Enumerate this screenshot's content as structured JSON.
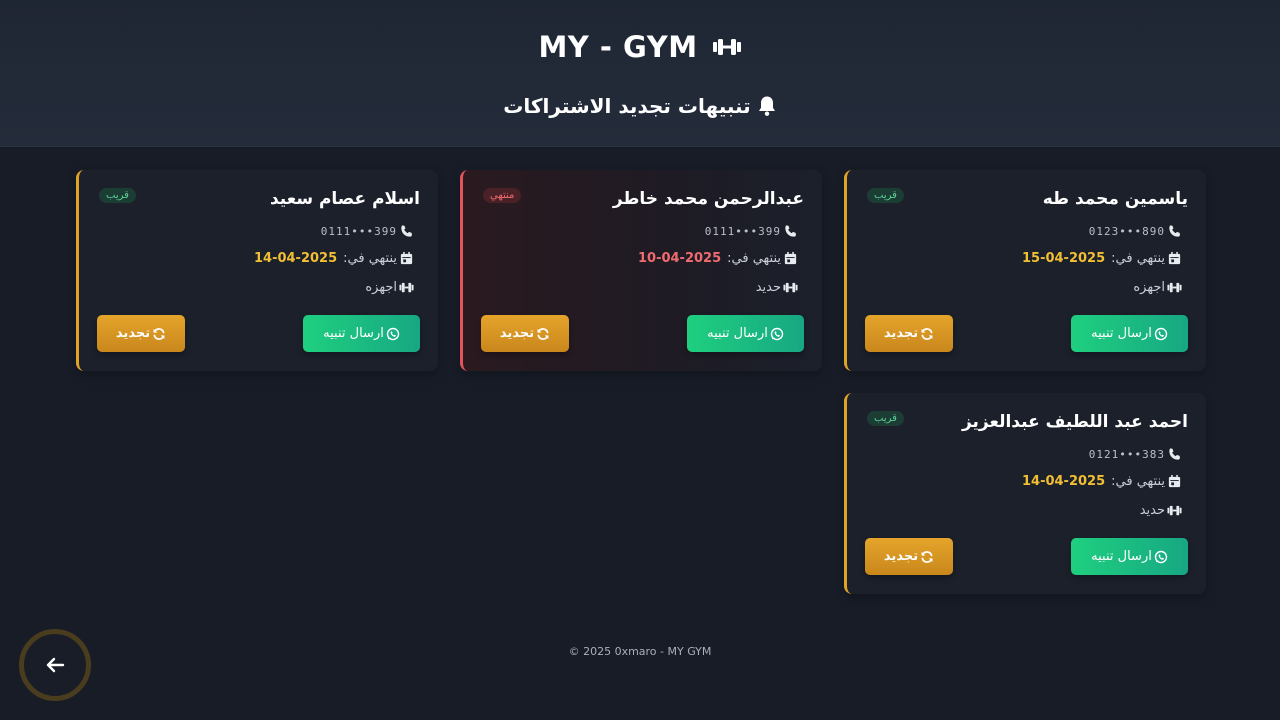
{
  "header": {
    "brand": "MY - GYM",
    "brand_icon": "dumbbell-icon",
    "subtitle": "تنبيهات تجديد الاشتراكات",
    "subtitle_icon": "bell-icon"
  },
  "labels": {
    "ends_on": "ينتهي في:",
    "send_alert": "ارسال تنبيه",
    "renew": "تجديد"
  },
  "colors": {
    "accent_gold": "#e0a328",
    "expired_red": "#e0545a",
    "whatsapp_green": "#1fcf7f",
    "date_yellow": "#f2bf33"
  },
  "cards": [
    {
      "name": "ياسمين محمد طه",
      "phone": "890•••0123",
      "end_date": "2025-04-15",
      "type": "اجهزه",
      "status": "قريب"
    },
    {
      "name": "عبدالرحمن محمد خاطر",
      "phone": "399•••0111",
      "end_date": "2025-04-10",
      "type": "حديد",
      "status": "منتهي"
    },
    {
      "name": "اسلام عصام سعيد",
      "phone": "399•••0111",
      "end_date": "2025-04-14",
      "type": "اجهزه",
      "status": "قريب"
    },
    {
      "name": "احمد عبد اللطيف عبدالعزيز",
      "phone": "383•••0121",
      "end_date": "2025-04-14",
      "type": "حديد",
      "status": "قريب"
    }
  ],
  "footer": {
    "text": "© 2025 0xmaro - MY GYM"
  },
  "back_button_icon": "arrow-left-icon"
}
